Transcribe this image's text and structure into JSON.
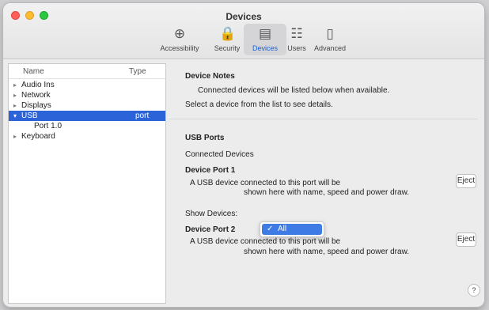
{
  "window": {
    "title": "Devices"
  },
  "toolbar": {
    "items": [
      {
        "label": "Accessibility",
        "icon": "accessibility-icon",
        "glyph": "⊕"
      },
      {
        "label": "Security",
        "icon": "lock-icon",
        "glyph": "🔒"
      },
      {
        "label": "Devices",
        "icon": "devices-icon",
        "glyph": "▤"
      },
      {
        "label": "Users",
        "icon": "users-icon",
        "glyph": "☷"
      },
      {
        "label": "Advanced",
        "icon": "advanced-icon",
        "glyph": "▯"
      }
    ]
  },
  "sidebar": {
    "col_name": "Name",
    "col_type": "Type",
    "rows": [
      {
        "label": "Audio Ins",
        "tri": "▸",
        "value": ""
      },
      {
        "label": "Network",
        "tri": "▸",
        "value": ""
      },
      {
        "label": "Displays",
        "tri": "▸",
        "value": ""
      },
      {
        "label": "USB",
        "tri": "▾",
        "value": "port",
        "selected": true
      },
      {
        "label": "Port 1.0",
        "tri": "",
        "value": ""
      },
      {
        "label": "Keyboard",
        "tri": "▸",
        "value": ""
      }
    ]
  },
  "main": {
    "section1_title": "Device Notes",
    "line1": "Connected devices will be listed below when available.",
    "line2": "Select a device from the list to see details.",
    "section2_title": "USB Ports",
    "subtitle": "Connected Devices",
    "port1_label": "Device Port 1",
    "port1_desc": "A USB device connected to this port will be",
    "port1_desc2": "shown here with name, speed and power draw.",
    "port2_label": "Device Port 2",
    "port2_desc": "A USB device connected to this port will be",
    "port2_desc2": "shown here with name, speed and power draw.",
    "show_label": "Show Devices:",
    "popup_value": "All",
    "button1": "Eject",
    "button2": "Eject",
    "help": "?"
  }
}
